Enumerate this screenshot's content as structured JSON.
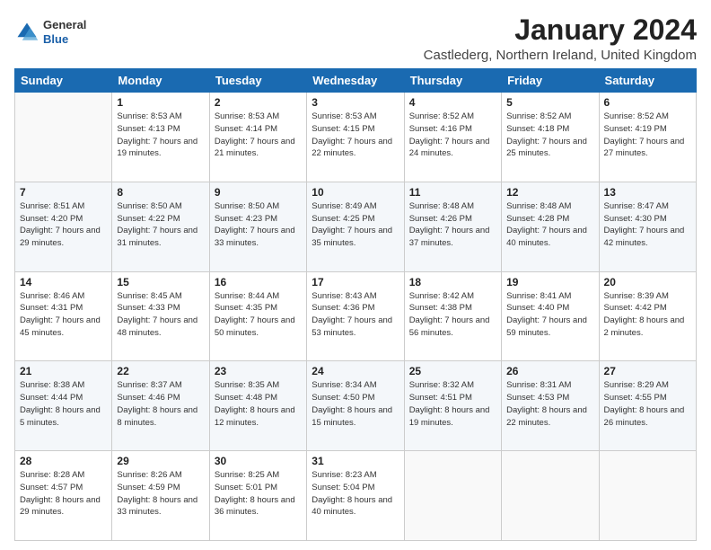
{
  "header": {
    "logo_general": "General",
    "logo_blue": "Blue",
    "month_title": "January 2024",
    "location": "Castlederg, Northern Ireland, United Kingdom"
  },
  "weekdays": [
    "Sunday",
    "Monday",
    "Tuesday",
    "Wednesday",
    "Thursday",
    "Friday",
    "Saturday"
  ],
  "weeks": [
    [
      {
        "day": "",
        "sunrise": "",
        "sunset": "",
        "daylight": ""
      },
      {
        "day": "1",
        "sunrise": "Sunrise: 8:53 AM",
        "sunset": "Sunset: 4:13 PM",
        "daylight": "Daylight: 7 hours and 19 minutes."
      },
      {
        "day": "2",
        "sunrise": "Sunrise: 8:53 AM",
        "sunset": "Sunset: 4:14 PM",
        "daylight": "Daylight: 7 hours and 21 minutes."
      },
      {
        "day": "3",
        "sunrise": "Sunrise: 8:53 AM",
        "sunset": "Sunset: 4:15 PM",
        "daylight": "Daylight: 7 hours and 22 minutes."
      },
      {
        "day": "4",
        "sunrise": "Sunrise: 8:52 AM",
        "sunset": "Sunset: 4:16 PM",
        "daylight": "Daylight: 7 hours and 24 minutes."
      },
      {
        "day": "5",
        "sunrise": "Sunrise: 8:52 AM",
        "sunset": "Sunset: 4:18 PM",
        "daylight": "Daylight: 7 hours and 25 minutes."
      },
      {
        "day": "6",
        "sunrise": "Sunrise: 8:52 AM",
        "sunset": "Sunset: 4:19 PM",
        "daylight": "Daylight: 7 hours and 27 minutes."
      }
    ],
    [
      {
        "day": "7",
        "sunrise": "Sunrise: 8:51 AM",
        "sunset": "Sunset: 4:20 PM",
        "daylight": "Daylight: 7 hours and 29 minutes."
      },
      {
        "day": "8",
        "sunrise": "Sunrise: 8:50 AM",
        "sunset": "Sunset: 4:22 PM",
        "daylight": "Daylight: 7 hours and 31 minutes."
      },
      {
        "day": "9",
        "sunrise": "Sunrise: 8:50 AM",
        "sunset": "Sunset: 4:23 PM",
        "daylight": "Daylight: 7 hours and 33 minutes."
      },
      {
        "day": "10",
        "sunrise": "Sunrise: 8:49 AM",
        "sunset": "Sunset: 4:25 PM",
        "daylight": "Daylight: 7 hours and 35 minutes."
      },
      {
        "day": "11",
        "sunrise": "Sunrise: 8:48 AM",
        "sunset": "Sunset: 4:26 PM",
        "daylight": "Daylight: 7 hours and 37 minutes."
      },
      {
        "day": "12",
        "sunrise": "Sunrise: 8:48 AM",
        "sunset": "Sunset: 4:28 PM",
        "daylight": "Daylight: 7 hours and 40 minutes."
      },
      {
        "day": "13",
        "sunrise": "Sunrise: 8:47 AM",
        "sunset": "Sunset: 4:30 PM",
        "daylight": "Daylight: 7 hours and 42 minutes."
      }
    ],
    [
      {
        "day": "14",
        "sunrise": "Sunrise: 8:46 AM",
        "sunset": "Sunset: 4:31 PM",
        "daylight": "Daylight: 7 hours and 45 minutes."
      },
      {
        "day": "15",
        "sunrise": "Sunrise: 8:45 AM",
        "sunset": "Sunset: 4:33 PM",
        "daylight": "Daylight: 7 hours and 48 minutes."
      },
      {
        "day": "16",
        "sunrise": "Sunrise: 8:44 AM",
        "sunset": "Sunset: 4:35 PM",
        "daylight": "Daylight: 7 hours and 50 minutes."
      },
      {
        "day": "17",
        "sunrise": "Sunrise: 8:43 AM",
        "sunset": "Sunset: 4:36 PM",
        "daylight": "Daylight: 7 hours and 53 minutes."
      },
      {
        "day": "18",
        "sunrise": "Sunrise: 8:42 AM",
        "sunset": "Sunset: 4:38 PM",
        "daylight": "Daylight: 7 hours and 56 minutes."
      },
      {
        "day": "19",
        "sunrise": "Sunrise: 8:41 AM",
        "sunset": "Sunset: 4:40 PM",
        "daylight": "Daylight: 7 hours and 59 minutes."
      },
      {
        "day": "20",
        "sunrise": "Sunrise: 8:39 AM",
        "sunset": "Sunset: 4:42 PM",
        "daylight": "Daylight: 8 hours and 2 minutes."
      }
    ],
    [
      {
        "day": "21",
        "sunrise": "Sunrise: 8:38 AM",
        "sunset": "Sunset: 4:44 PM",
        "daylight": "Daylight: 8 hours and 5 minutes."
      },
      {
        "day": "22",
        "sunrise": "Sunrise: 8:37 AM",
        "sunset": "Sunset: 4:46 PM",
        "daylight": "Daylight: 8 hours and 8 minutes."
      },
      {
        "day": "23",
        "sunrise": "Sunrise: 8:35 AM",
        "sunset": "Sunset: 4:48 PM",
        "daylight": "Daylight: 8 hours and 12 minutes."
      },
      {
        "day": "24",
        "sunrise": "Sunrise: 8:34 AM",
        "sunset": "Sunset: 4:50 PM",
        "daylight": "Daylight: 8 hours and 15 minutes."
      },
      {
        "day": "25",
        "sunrise": "Sunrise: 8:32 AM",
        "sunset": "Sunset: 4:51 PM",
        "daylight": "Daylight: 8 hours and 19 minutes."
      },
      {
        "day": "26",
        "sunrise": "Sunrise: 8:31 AM",
        "sunset": "Sunset: 4:53 PM",
        "daylight": "Daylight: 8 hours and 22 minutes."
      },
      {
        "day": "27",
        "sunrise": "Sunrise: 8:29 AM",
        "sunset": "Sunset: 4:55 PM",
        "daylight": "Daylight: 8 hours and 26 minutes."
      }
    ],
    [
      {
        "day": "28",
        "sunrise": "Sunrise: 8:28 AM",
        "sunset": "Sunset: 4:57 PM",
        "daylight": "Daylight: 8 hours and 29 minutes."
      },
      {
        "day": "29",
        "sunrise": "Sunrise: 8:26 AM",
        "sunset": "Sunset: 4:59 PM",
        "daylight": "Daylight: 8 hours and 33 minutes."
      },
      {
        "day": "30",
        "sunrise": "Sunrise: 8:25 AM",
        "sunset": "Sunset: 5:01 PM",
        "daylight": "Daylight: 8 hours and 36 minutes."
      },
      {
        "day": "31",
        "sunrise": "Sunrise: 8:23 AM",
        "sunset": "Sunset: 5:04 PM",
        "daylight": "Daylight: 8 hours and 40 minutes."
      },
      {
        "day": "",
        "sunrise": "",
        "sunset": "",
        "daylight": ""
      },
      {
        "day": "",
        "sunrise": "",
        "sunset": "",
        "daylight": ""
      },
      {
        "day": "",
        "sunrise": "",
        "sunset": "",
        "daylight": ""
      }
    ]
  ]
}
